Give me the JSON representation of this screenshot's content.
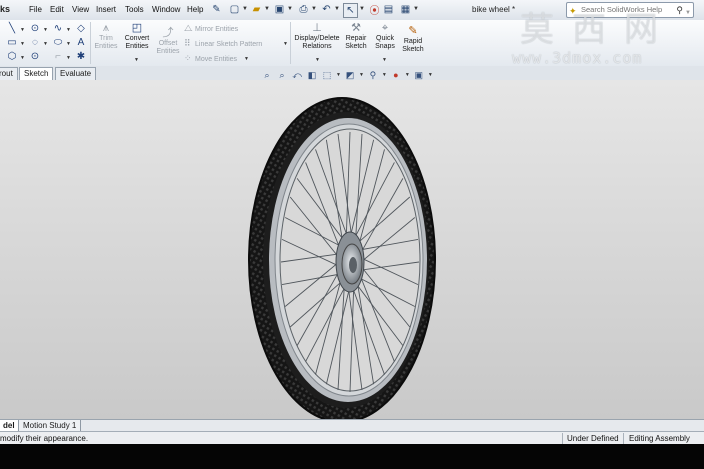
{
  "menubar": {
    "app_name": "ks",
    "items": [
      "File",
      "Edit",
      "View",
      "Insert",
      "Tools",
      "Window",
      "Help"
    ],
    "doc_title": "bike wheel *",
    "search_placeholder": "Search SolidWorks Help"
  },
  "ribbon": {
    "trim": "Trim Entities",
    "convert": "Convert Entities",
    "offset": "Offset Entities",
    "mirror": "Mirror Entities",
    "linear_pattern": "Linear Sketch Pattern",
    "move": "Move Entities",
    "display_delete": "Display/Delete Relations",
    "repair": "Repair Sketch",
    "quick_snaps": "Quick Snaps",
    "rapid": "Rapid Sketch"
  },
  "tabs": [
    "rout",
    "Sketch",
    "Evaluate"
  ],
  "bottom_tabs": [
    "del",
    "Motion Study 1"
  ],
  "status": {
    "message": "modify their appearance.",
    "sketch_state": "Under Defined",
    "mode": "Editing Assembly"
  },
  "watermark": {
    "chinese": "莫西网",
    "url": "www.3dmox.com"
  },
  "colors": {
    "accent": "#1f3f78",
    "tire": "#151515",
    "rim": "#9aa0a6"
  }
}
